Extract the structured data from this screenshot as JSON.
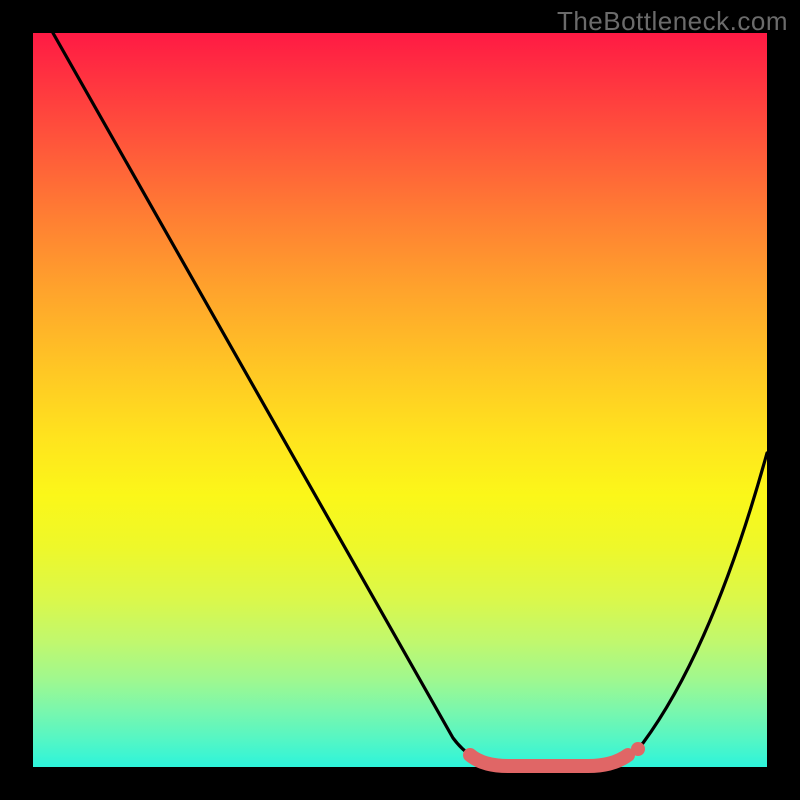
{
  "watermark": "TheBottleneck.com",
  "colors": {
    "frame": "#000000",
    "curve": "#000000",
    "marker_fill": "#e06666",
    "marker_stroke": "#c24b4b"
  },
  "chart_data": {
    "type": "line",
    "title": "",
    "xlabel": "",
    "ylabel": "",
    "xlim": [
      0,
      100
    ],
    "ylim": [
      0,
      100
    ],
    "grid": false,
    "series": [
      {
        "name": "bottleneck-curve",
        "x": [
          0,
          10,
          20,
          30,
          40,
          50,
          58,
          62,
          68,
          74,
          80,
          86,
          92,
          100
        ],
        "y": [
          100,
          83,
          66,
          49,
          33,
          17,
          4,
          1,
          0,
          0,
          1,
          6,
          16,
          42
        ]
      }
    ],
    "markers": [
      {
        "name": "flat-region-start",
        "x": 62,
        "y": 1
      },
      {
        "name": "flat-region-end",
        "x": 80,
        "y": 1
      }
    ]
  }
}
